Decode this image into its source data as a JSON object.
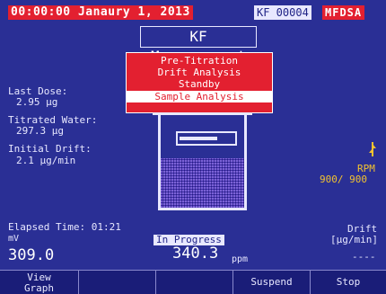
{
  "status": {
    "datetime": "00:00:00 Janaury 1, 2013",
    "instrument_id": "KF 00004",
    "brand": "MFDSA"
  },
  "title": "KF Measurement",
  "modes": [
    "Pre-Titration",
    "Drift Analysis",
    "Standby",
    "Sample Analysis"
  ],
  "selected_mode": "Sample Analysis",
  "readings": {
    "last_dose_label": "Last Dose:",
    "last_dose_value": "2.95 µg",
    "titrated_water_label": "Titrated Water:",
    "titrated_water_value": "297.3 µg",
    "initial_drift_label": "Initial Drift:",
    "initial_drift_value": "2.1 µg/min",
    "rpm_label": "RPM",
    "rpm_value": "900/ 900",
    "elapsed_label": "Elapsed Time: 01:21",
    "mv_label": "mV",
    "mv_value": "309.0",
    "status_text": "In Progress",
    "ppm_value": "340.3",
    "ppm_unit": "ppm",
    "drift_label": "Drift",
    "drift_unit": "[µg/min]",
    "drift_value": "----"
  },
  "burette_fill": 0.68,
  "softkeys": [
    "View Graph",
    "",
    "",
    "Suspend",
    "Stop"
  ],
  "colors": {
    "background": "#2a2f95",
    "accent_red": "#e32030",
    "text": "#e8e8ff"
  }
}
